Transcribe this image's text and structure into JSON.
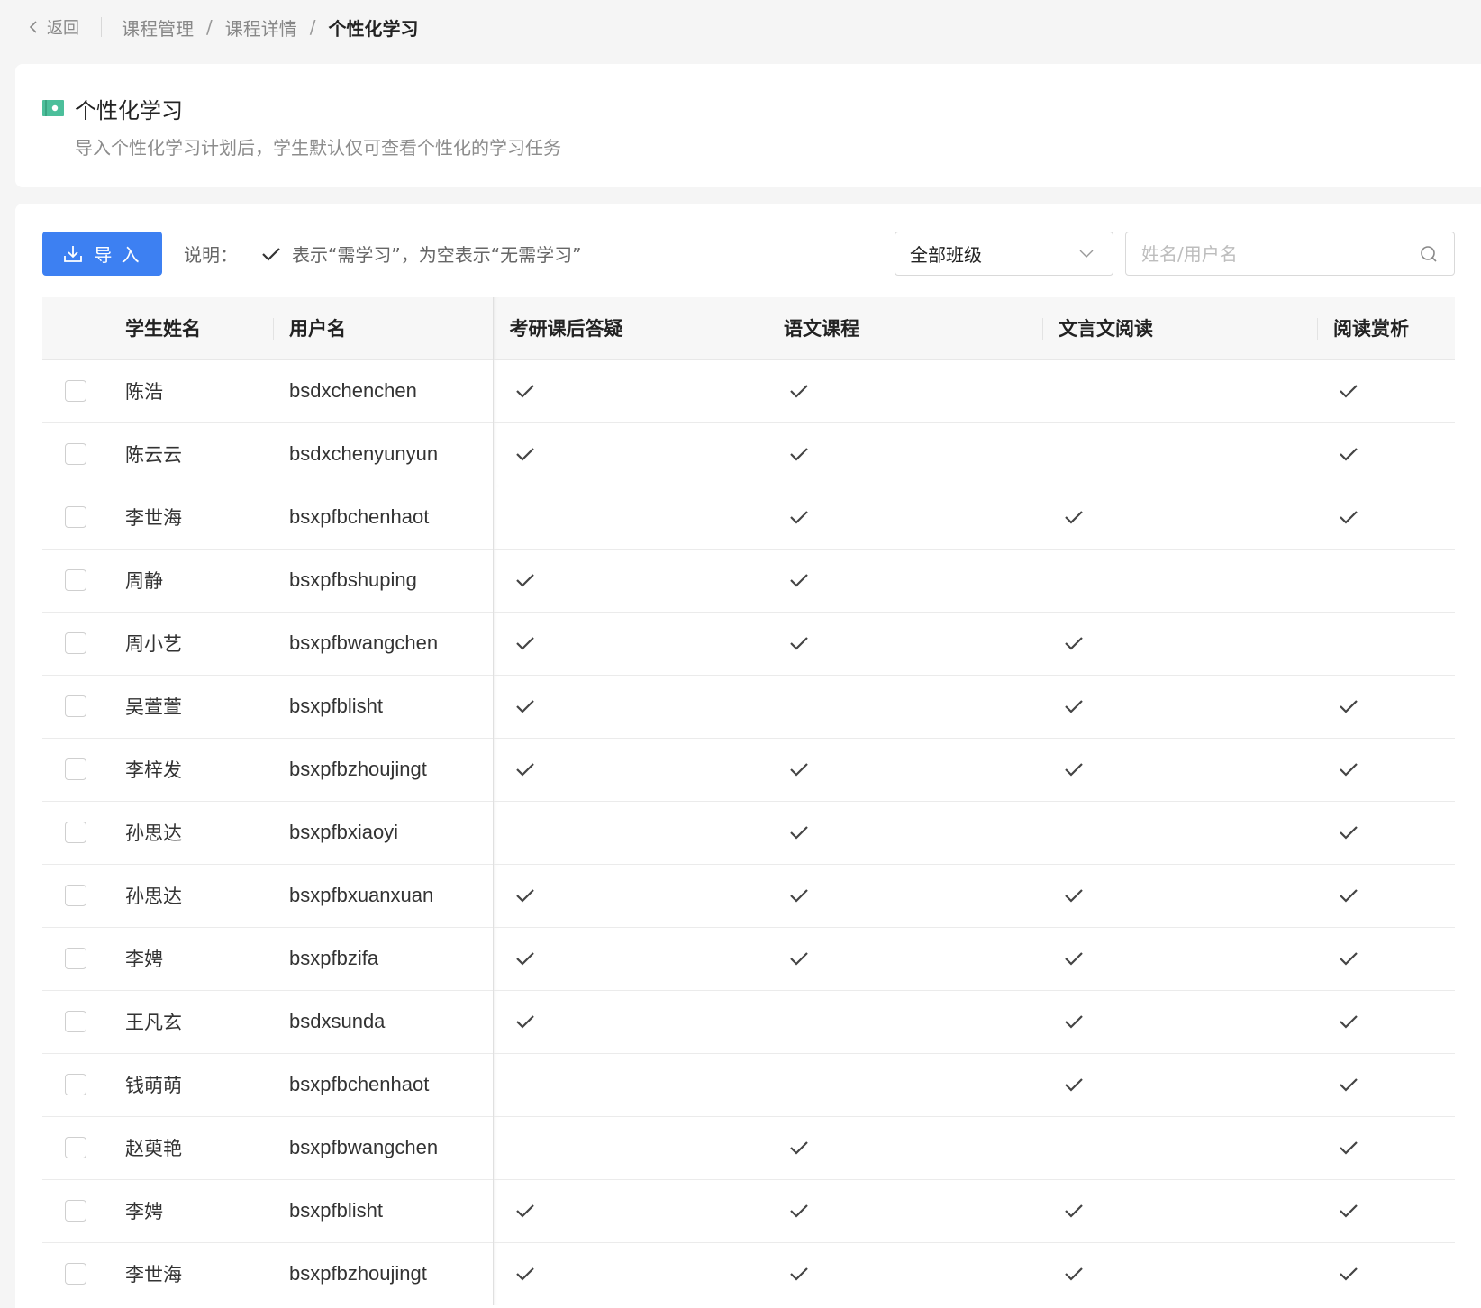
{
  "breadcrumb": {
    "back_label": "返回",
    "items": [
      "课程管理",
      "课程详情"
    ],
    "separator": "/",
    "current": "个性化学习"
  },
  "header": {
    "title": "个性化学习",
    "subtitle": "导入个性化学习计划后，学生默认仅可查看个性化的学习任务",
    "icon": "book-icon",
    "icon_color": "#4cbf9b"
  },
  "toolbar": {
    "import_label": "导 入",
    "legend_prefix": "说明：",
    "legend_text": "表示“需学习”，为空表示“无需学习”",
    "class_select_value": "全部班级",
    "search_placeholder": "姓名/用户名",
    "accent_color": "#3d80f2"
  },
  "table": {
    "headers": {
      "name": "学生姓名",
      "username": "用户名",
      "subjects": [
        "考研课后答疑",
        "语文课程",
        "文言文阅读",
        "阅读赏析"
      ]
    },
    "rows": [
      {
        "name": "陈浩",
        "username": "bsdxchenchen",
        "marks": [
          true,
          true,
          false,
          true
        ]
      },
      {
        "name": "陈云云",
        "username": "bsdxchenyunyun",
        "marks": [
          true,
          true,
          false,
          true
        ]
      },
      {
        "name": "李世海",
        "username": "bsxpfbchenhaot",
        "marks": [
          false,
          true,
          true,
          true
        ]
      },
      {
        "name": "周静",
        "username": "bsxpfbshuping",
        "marks": [
          true,
          true,
          false,
          false
        ]
      },
      {
        "name": "周小艺",
        "username": "bsxpfbwangchen",
        "marks": [
          true,
          true,
          true,
          false
        ]
      },
      {
        "name": "吴萱萱",
        "username": "bsxpfblisht",
        "marks": [
          true,
          false,
          true,
          true
        ]
      },
      {
        "name": "李梓发",
        "username": "bsxpfbzhoujingt",
        "marks": [
          true,
          true,
          true,
          true
        ]
      },
      {
        "name": "孙思达",
        "username": "bsxpfbxiaoyi",
        "marks": [
          false,
          true,
          false,
          true
        ]
      },
      {
        "name": "孙思达",
        "username": "bsxpfbxuanxuan",
        "marks": [
          true,
          true,
          true,
          true
        ]
      },
      {
        "name": "李娉",
        "username": "bsxpfbzifa",
        "marks": [
          true,
          true,
          true,
          true
        ]
      },
      {
        "name": "王凡玄",
        "username": "bsdxsunda",
        "marks": [
          true,
          false,
          true,
          true
        ]
      },
      {
        "name": "钱萌萌",
        "username": "bsxpfbchenhaot",
        "marks": [
          false,
          false,
          true,
          true
        ]
      },
      {
        "name": "赵萸艳",
        "username": "bsxpfbwangchen",
        "marks": [
          false,
          true,
          false,
          true
        ]
      },
      {
        "name": "李娉",
        "username": "bsxpfblisht",
        "marks": [
          true,
          true,
          true,
          true
        ]
      },
      {
        "name": "李世海",
        "username": "bsxpfbzhoujingt",
        "marks": [
          true,
          true,
          true,
          true
        ]
      }
    ]
  }
}
